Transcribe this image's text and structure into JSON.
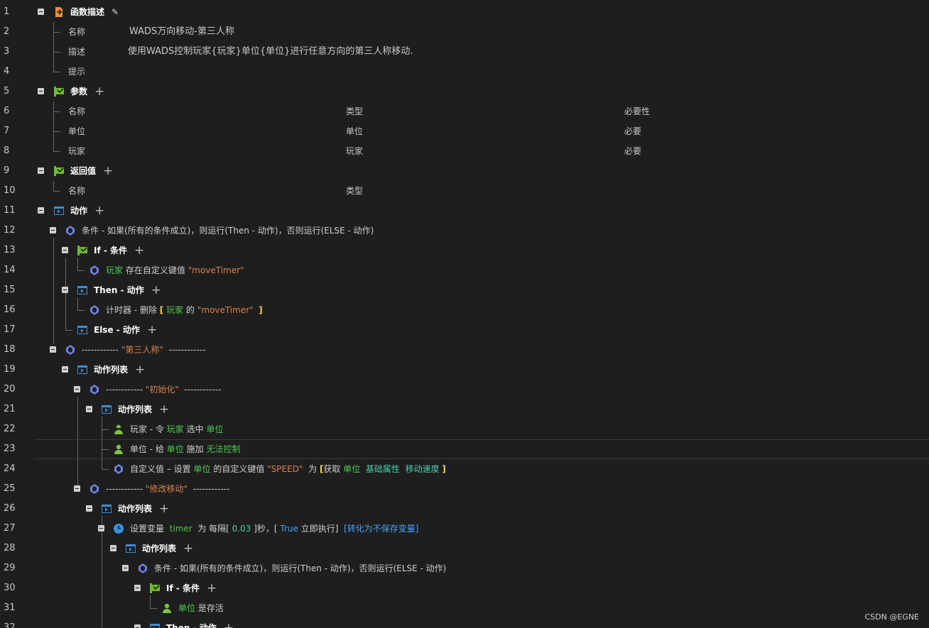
{
  "lines": [
    "1",
    "2",
    "3",
    "4",
    "5",
    "6",
    "7",
    "8",
    "9",
    "10",
    "11",
    "12",
    "13",
    "14",
    "15",
    "16",
    "17",
    "18",
    "19",
    "20",
    "21",
    "22",
    "23",
    "24",
    "25",
    "26",
    "27",
    "28",
    "29",
    "30",
    "31",
    "32"
  ],
  "desc": {
    "header": "函数描述",
    "name_label": "名称",
    "name_value": "WADS万向移动-第三人称",
    "desc_label": "描述",
    "desc_value": "使用WADS控制玩家{玩家}单位{单位}进行任意方向的第三人称移动.",
    "hint_label": "提示"
  },
  "params": {
    "header": "参数",
    "col_name": "名称",
    "col_type": "类型",
    "col_required": "必要性",
    "rows": [
      {
        "name": "单位",
        "type": "单位",
        "required": "必要"
      },
      {
        "name": "玩家",
        "type": "玩家",
        "required": "必要"
      }
    ]
  },
  "ret": {
    "header": "返回值",
    "col_name": "名称",
    "col_type": "类型"
  },
  "actions": {
    "header": "动作",
    "cond1": "条件 - 如果(所有的条件成立)，则运行(Then - 动作)，否则运行(ELSE - 动作)",
    "if1": "If - 条件",
    "if1_player": "玩家",
    "if1_text": "存在自定义键值",
    "if1_key": "\"moveTimer\"",
    "then1": "Then - 动作",
    "then1_a": "计时器 - 删除",
    "then1_br_l": "[",
    "then1_player": "玩家",
    "then1_of": "的",
    "then1_key": "\"moveTimer\"",
    "then1_br_r": "]",
    "else1": "Else - 动作",
    "sep1_dashes": "------------",
    "sep1_title": "\"第三人称\"",
    "sep1_dashes_r": "------------",
    "list1": "动作列表",
    "sep2_dashes": "------------",
    "sep2_title": "\"初始化\"",
    "sep2_dashes_r": "------------",
    "list2": "动作列表",
    "a22_a": "玩家 - 令",
    "a22_p": "玩家",
    "a22_b": "选中",
    "a22_u": "单位",
    "a23_a": "单位 - 给",
    "a23_u": "单位",
    "a23_b": "施加",
    "a23_s": "无法控制",
    "a24_a": "自定义值 – 设置",
    "a24_u": "单位",
    "a24_b": "的自定义键值",
    "a24_k": "\"SPEED\"",
    "a24_c": "为",
    "a24_br_l": "[",
    "a24_get": "获取",
    "a24_u2": "单位",
    "a24_attr": "基础属性",
    "a24_spd": "移动速度",
    "a24_br_r": "]",
    "sep3_dashes": "------------",
    "sep3_title": "\"修改移动\"",
    "sep3_dashes_r": "------------",
    "list3": "动作列表",
    "a27_a": "设置变量",
    "a27_var": "timer",
    "a27_b": "为 每隔[",
    "a27_num": "0.03",
    "a27_c": "]秒，[",
    "a27_true": "True",
    "a27_d": "立即执行]",
    "a27_conv": "[转化为不保存变量]",
    "list4": "动作列表",
    "cond2": "条件 - 如果(所有的条件成立)，则运行(Then - 动作)，否则运行(ELSE - 动作)",
    "if2": "If - 条件",
    "a31_u": "单位",
    "a31_b": "是存活",
    "then2": "Then - 动作"
  },
  "watermark": "CSDN @EGNE",
  "colors": {
    "bg": "#1e1e1e",
    "green_var": "#4ec94e",
    "cyan_var": "#4ec9b0",
    "string": "#d7834d",
    "bracket": "#f2d33a",
    "blue": "#4a9ef5"
  },
  "icons": [
    "function-icon",
    "pencil-icon",
    "param-flag-icon",
    "action-play-icon",
    "condition-icon",
    "player-icon",
    "unit-icon",
    "timer-icon",
    "plus-icon"
  ]
}
